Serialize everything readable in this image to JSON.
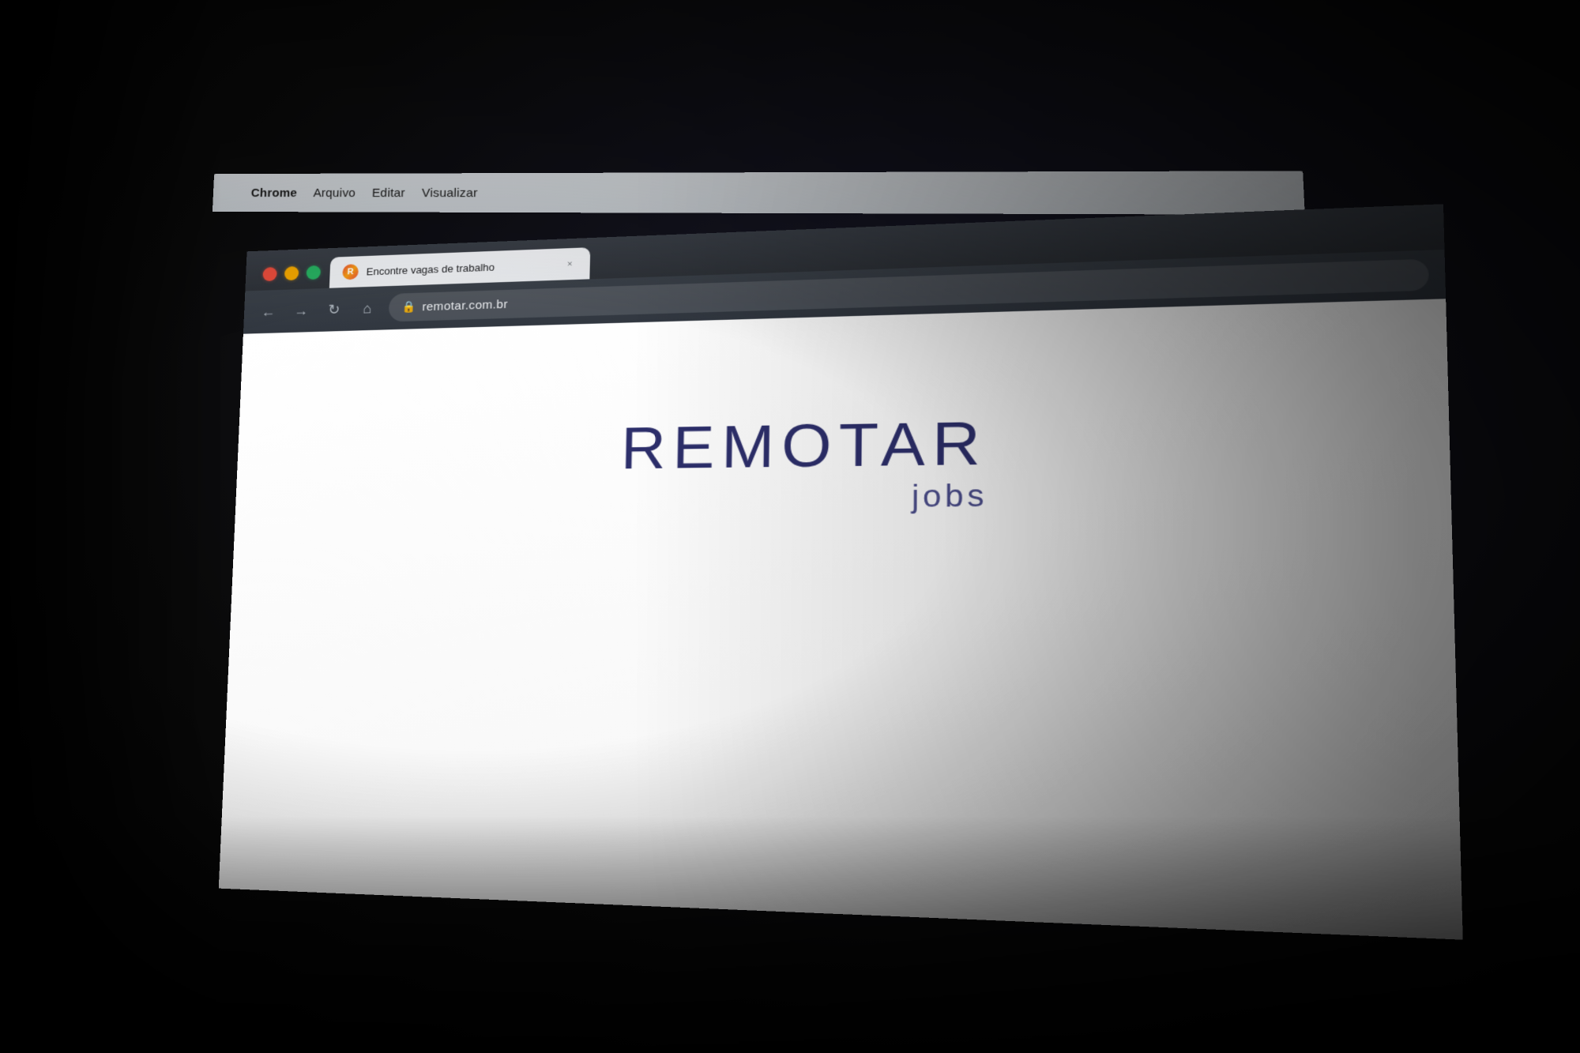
{
  "scene": {
    "background": "#000000"
  },
  "menubar": {
    "apple_symbol": "",
    "items": [
      {
        "label": "Chrome",
        "bold": true
      },
      {
        "label": "Arquivo",
        "bold": false
      },
      {
        "label": "Editar",
        "bold": false
      },
      {
        "label": "Visualizar",
        "bold": false
      }
    ]
  },
  "browser": {
    "tab": {
      "favicon_letter": "R",
      "title": "Encontre vagas de trabalho",
      "close_symbol": "×"
    },
    "navigation": {
      "back_symbol": "←",
      "forward_symbol": "→",
      "reload_symbol": "↻",
      "home_symbol": "⌂",
      "lock_symbol": "🔒",
      "url": "remotar.com.br"
    }
  },
  "webpage": {
    "logo_text": "REMOTAR",
    "logo_sub": "jobs"
  }
}
